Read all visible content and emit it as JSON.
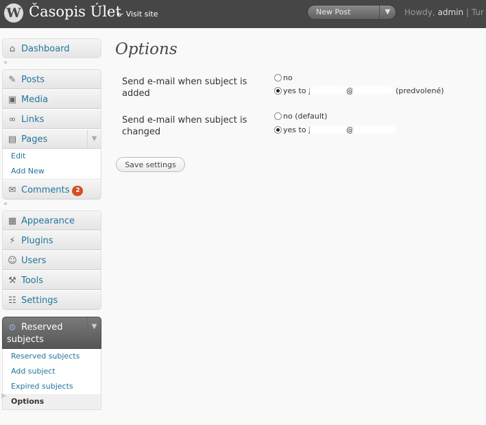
{
  "header": {
    "logo": "W",
    "site_title": "Časopis Úlet",
    "visit_site": "← Visit site",
    "favorite_action": "New Post",
    "howdy_prefix": "Howdy, ",
    "user": "admin",
    "separator": " | ",
    "trailing": "Tur"
  },
  "menu": {
    "dashboard": "Dashboard",
    "posts": "Posts",
    "media": "Media",
    "links": "Links",
    "pages": "Pages",
    "pages_sub": [
      "Edit",
      "Add New"
    ],
    "comments": "Comments",
    "comments_count": "2",
    "appearance": "Appearance",
    "plugins": "Plugins",
    "users": "Users",
    "tools": "Tools",
    "settings": "Settings",
    "reserved": "Reserved subjects",
    "reserved_sub": [
      "Reserved subjects",
      "Add subject",
      "Expired subjects",
      "Options"
    ]
  },
  "main": {
    "title": "Options",
    "added": {
      "label": "Send e-mail when subject is added",
      "opt_no": "no",
      "opt_yes_prefix": "yes to j",
      "opt_yes_at": "@",
      "opt_yes_suffix": "(predvolené)"
    },
    "changed": {
      "label": "Send e-mail when subject is changed",
      "opt_no": "no (default)",
      "opt_yes_prefix": "yes to j",
      "opt_yes_at": "@"
    },
    "save": "Save settings"
  },
  "icons": {
    "dashboard": "house-icon",
    "posts": "pushpin-icon",
    "media": "media-icon",
    "links": "chain-link-icon",
    "pages": "pages-icon",
    "comments": "speech-bubble-icon",
    "appearance": "appearance-icon",
    "plugins": "plug-icon",
    "users": "users-icon",
    "tools": "tools-icon",
    "settings": "settings-icon",
    "reserved": "gear-icon"
  },
  "colors": {
    "header_bg": "#464646",
    "link": "#21759b",
    "badge": "#d54e21"
  }
}
